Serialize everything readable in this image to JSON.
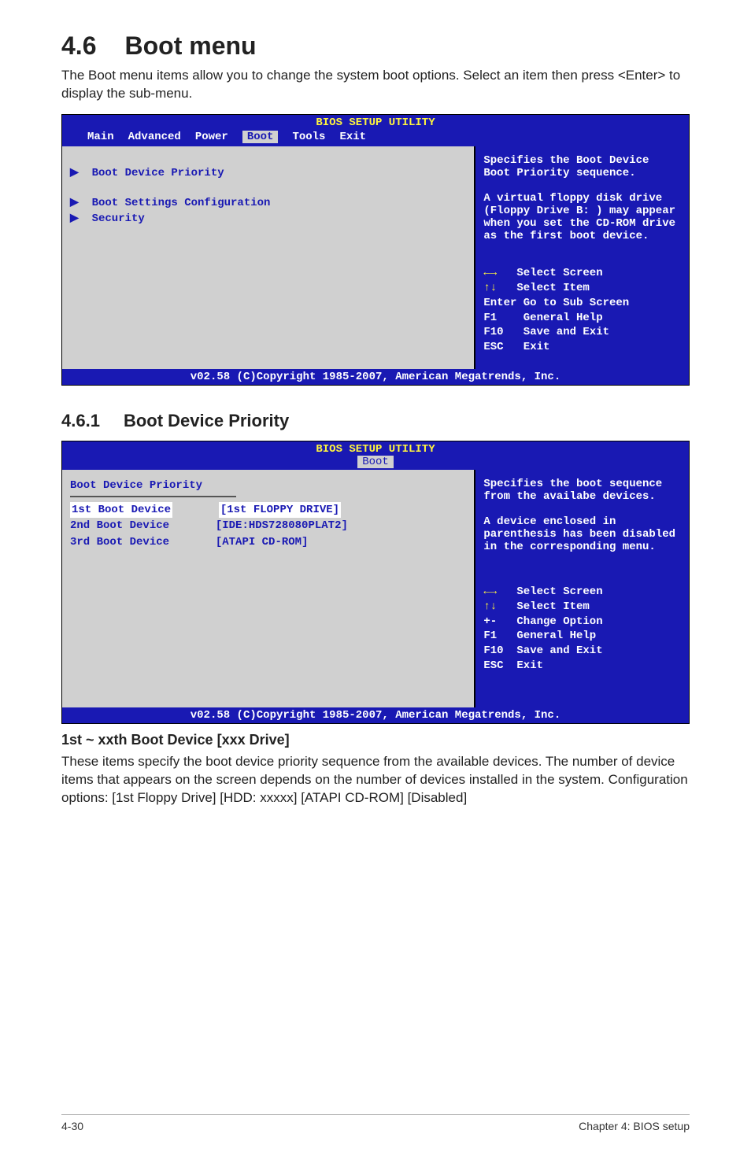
{
  "heading": {
    "num": "4.6",
    "title": "Boot menu"
  },
  "intro": "The Boot menu items allow you to change the system boot options. Select an item then press <Enter> to display the sub-menu.",
  "bios1": {
    "title": "BIOS SETUP UTILITY",
    "tabs": [
      "Main",
      "Advanced",
      "Power",
      "Boot",
      "Tools",
      "Exit"
    ],
    "items": [
      "Boot Device Priority",
      "Boot Settings Configuration",
      "Security"
    ],
    "help1": "Specifies the Boot Device Boot Priority sequence.",
    "help2": "A virtual floppy disk drive (Floppy Drive B: ) may appear when you set the CD-ROM drive as the first boot device.",
    "legend": [
      {
        "k": "←→",
        "v": "Select Screen"
      },
      {
        "k": "↑↓",
        "v": "Select Item"
      },
      {
        "k": "Enter",
        "v": "Go to Sub Screen"
      },
      {
        "k": "F1",
        "v": "General Help"
      },
      {
        "k": "F10",
        "v": "Save and Exit"
      },
      {
        "k": "ESC",
        "v": "Exit"
      }
    ],
    "footer": "v02.58 (C)Copyright 1985-2007, American Megatrends, Inc."
  },
  "sub": {
    "num": "4.6.1",
    "title": "Boot Device Priority"
  },
  "bios2": {
    "title": "BIOS SETUP UTILITY",
    "tab": "Boot",
    "header": "Boot Device Priority",
    "rows": [
      {
        "l": "1st Boot Device",
        "r": "[1st FLOPPY DRIVE]"
      },
      {
        "l": "2nd Boot Device",
        "r": "[IDE:HDS728080PLAT2]"
      },
      {
        "l": "3rd Boot Device",
        "r": "[ATAPI CD-ROM]"
      }
    ],
    "help": "Specifies the boot sequence from the availabe devices.\n\nA device enclosed in parenthesis has been disabled in the corresponding menu.",
    "legend": [
      {
        "k": "←→",
        "v": "Select Screen"
      },
      {
        "k": "↑↓",
        "v": "Select Item"
      },
      {
        "k": "+-",
        "v": "Change Option"
      },
      {
        "k": "F1",
        "v": "General Help"
      },
      {
        "k": "F10",
        "v": "Save and Exit"
      },
      {
        "k": "ESC",
        "v": "Exit"
      }
    ],
    "footer": "v02.58 (C)Copyright 1985-2007, American Megatrends, Inc."
  },
  "itemhead": "1st ~ xxth Boot Device [xxx Drive]",
  "itembody": "These items specify the boot device priority sequence from the available devices. The number of device items that appears on the screen depends on the number of devices installed in the system. Configuration options: [1st Floppy Drive] [HDD: xxxxx] [ATAPI CD-ROM] [Disabled]",
  "footer": {
    "l": "4-30",
    "r": "Chapter 4: BIOS setup"
  }
}
